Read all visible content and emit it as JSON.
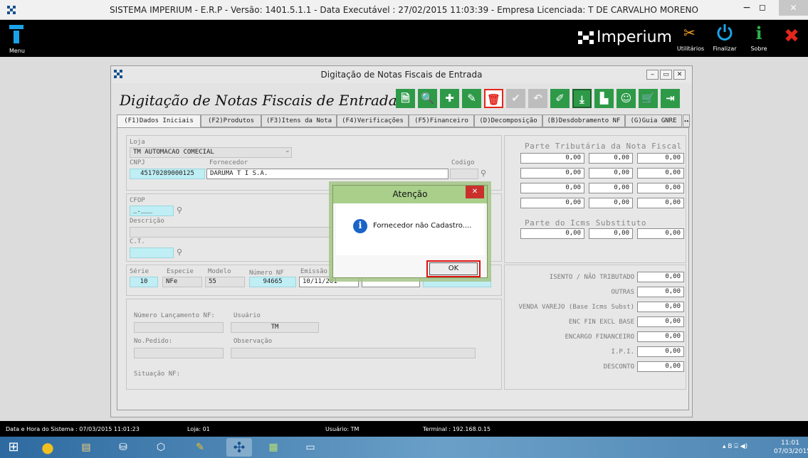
{
  "window": {
    "title": "SISTEMA IMPERIUM - E.R.P - Versão: 1401.5.1.1 - Data Executável : 27/02/2015 11:03:39 - Empresa Licenciada: T DE CARVALHO MORENO",
    "min_glyph": "−",
    "max_glyph": "◻",
    "close_glyph": "✕"
  },
  "topbar": {
    "menu_label": "Menu",
    "brand": "Imperium",
    "utilities_label": "Utilitários",
    "finalize_label": "Finalizar",
    "about_label": "Sobre",
    "about_glyph": "i",
    "exit_glyph": "✖",
    "accent_color": "#1aa3e8",
    "exit_color": "#e3261c"
  },
  "form": {
    "window_title": "Digitação de Notas Fiscais de Entrada",
    "heading": "Digitação de Notas Fiscais de Entrada",
    "win_min": "‒",
    "win_max": "▭",
    "win_close": "✕",
    "toolbar_icons": [
      "file-icon",
      "search-icon",
      "add-icon",
      "edit-icon",
      "delete-icon",
      "confirm-icon",
      "undo-icon",
      "clear-icon",
      "import-icon",
      "factory-icon",
      "user-icon",
      "cart-icon",
      "exit-icon"
    ],
    "toolbar_glyphs": [
      "🗎",
      "🔍",
      "✚",
      "✎",
      "🗑",
      "✔",
      "↶",
      "✐",
      "⤓",
      "▙",
      "☺",
      "🛒",
      "⇥"
    ],
    "tabs": [
      "(F1)Dados Iniciais",
      "(F2)Produtos",
      "(F3)Itens da Nota",
      "(F4)Verificações",
      "(F5)Financeiro",
      "(D)Decomposição",
      "(B)Desdobramento NF",
      "(G)Guia GNRE"
    ],
    "tab_scroll_glyph": "◂▸",
    "loja": {
      "label": "Loja",
      "value": "TM AUTOMACAO COMECIAL"
    },
    "cnpj": {
      "label": "CNPJ",
      "value": "45170289000125"
    },
    "fornecedor": {
      "label": "Fornecedor",
      "value": "DARUMA T I S.A."
    },
    "codigo": {
      "label": "Codigo",
      "value": ""
    },
    "cfop": {
      "label": "CFOP",
      "value": "_.___"
    },
    "descricao": {
      "label": "Descrição",
      "value": ""
    },
    "ct": {
      "label": "C.T.",
      "value": ""
    },
    "serie": {
      "label": "Série",
      "value": "10"
    },
    "especie": {
      "label": "Especie",
      "value": "NFe"
    },
    "modelo": {
      "label": "Modelo",
      "value": "55"
    },
    "numero_nf": {
      "label": "Número NF",
      "value": "94665"
    },
    "emissao": {
      "label": "Emissão",
      "value": "10/11/201"
    },
    "numero_lancamento": {
      "label": "Número Lançamento NF:",
      "value": ""
    },
    "usuario": {
      "label": "Usuário",
      "value": "TM"
    },
    "no_pedido": {
      "label": "No.Pedido:",
      "value": ""
    },
    "observacao": {
      "label": "Observação",
      "value": ""
    },
    "situacao": {
      "label": "Situação NF:"
    },
    "parte_tributaria": {
      "title": "Parte Tributária da Nota Fiscal",
      "rows": [
        [
          "0,00",
          "0,00",
          "0,00"
        ],
        [
          "0,00",
          "0,00",
          "0,00"
        ],
        [
          "0,00",
          "0,00",
          "0,00"
        ],
        [
          "0,00",
          "0,00",
          "0,00"
        ]
      ]
    },
    "parte_icms": {
      "title": "Parte do Icms Substituto",
      "values": [
        "0,00",
        "0,00",
        "0,00"
      ]
    },
    "totais": [
      {
        "label": "ISENTO / NÃO TRIBUTADO",
        "value": "0,00"
      },
      {
        "label": "OUTRAS",
        "value": "0,00"
      },
      {
        "label": "VENDA VAREJO (Base Icms Subst)",
        "value": "0,00"
      },
      {
        "label": "ENC FIN EXCL BASE",
        "value": "0,00"
      },
      {
        "label": "ENCARGO FINANCEIRO",
        "value": "0,00"
      },
      {
        "label": "I.P.I.",
        "value": "0,00"
      },
      {
        "label": "DESCONTO",
        "value": "0,00"
      }
    ]
  },
  "dialog": {
    "title": "Atenção",
    "close_glyph": "✕",
    "info_glyph": "i",
    "message": "Fornecedor não Cadastro....",
    "ok_label": "OK"
  },
  "statusbar": {
    "datetime": "Data e Hora do Sistema : 07/03/2015 11:01:23",
    "loja": "Loja: 01",
    "usuario": "Usuário: TM",
    "terminal": "Terminal : 192.168.0.15"
  },
  "taskbar": {
    "apps": [
      "windows-start-icon",
      "chrome-icon",
      "file-explorer-icon",
      "network-icon",
      "virtualbox-icon",
      "paint-tool-icon",
      "imperium-icon",
      "project-icon",
      "remote-desktop-icon"
    ],
    "app_glyphs": [
      "⊞",
      "●",
      "▤",
      "⛁",
      "⬡",
      "✎",
      "✣",
      "▦",
      "▭"
    ],
    "tray": "▴  B  ⌸  ◀)",
    "time": "11:01",
    "date": "07/03/2015"
  }
}
